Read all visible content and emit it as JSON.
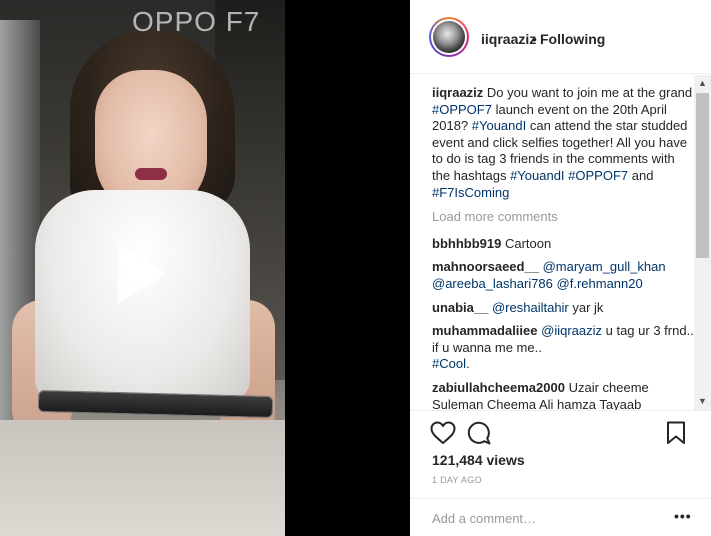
{
  "media": {
    "brand_text": "OPPO F7"
  },
  "header": {
    "username": "iiqraaziz",
    "separator": "•",
    "follow_status": "Following"
  },
  "caption": {
    "username": "iiqraaziz",
    "t1": " Do you want to join me at the grand ",
    "tag1": "#OPPOF7",
    "t2": " launch event on the 20th April 2018? ",
    "tag2": "#YouandI",
    "t3": " can attend the star studded event and click selfies together! All you have to do is tag 3 friends in the comments with the hashtags ",
    "tag3": "#YouandI",
    "t4": " ",
    "tag4": "#OPPOF7",
    "t5": " and ",
    "tag5": "#F7IsComing"
  },
  "load_more": "Load more comments",
  "comments": [
    {
      "user": "bbhhbb919",
      "text": " Cartoon"
    },
    {
      "user": "mahnoorsaeed__",
      "mention1": "@maryam_gull_khan",
      "mention2": "@areeba_lashari786",
      "mention3": "@f.rehmann20"
    },
    {
      "user": "unabia__",
      "mention1": "@reshailtahir",
      "text": " yar jk"
    },
    {
      "user": "muhammadaliiee",
      "mention1": "@iiqraaziz",
      "text1": " u tag ur 3 frnd..",
      "text2": "if u wanna me me..",
      "tag": "#Cool",
      "text3": "."
    },
    {
      "user": "zabiullahcheema2000",
      "text": " Uzair cheeme Suleman Cheema Ali hamza Tayaab"
    }
  ],
  "stats": {
    "views": "121,484 views",
    "time_ago": "1 DAY AGO"
  },
  "add_comment": {
    "placeholder": "Add a comment…",
    "more": "•••"
  },
  "icons": {
    "like": "heart-icon",
    "comment": "comment-icon",
    "save": "bookmark-icon",
    "play": "play-icon"
  },
  "colors": {
    "link": "#003569",
    "text": "#262626",
    "muted": "#999999"
  }
}
